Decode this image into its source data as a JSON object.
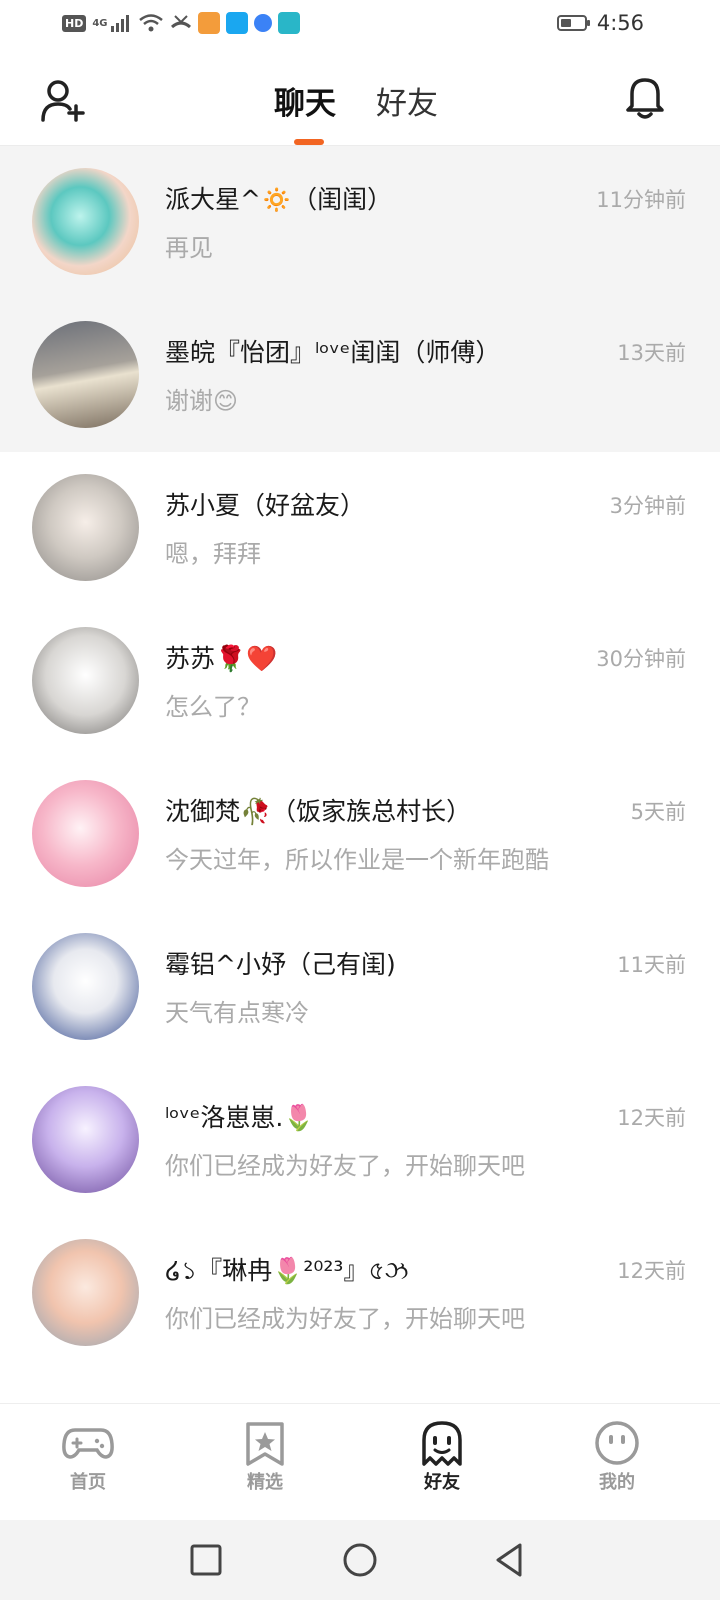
{
  "status_bar": {
    "network_hd": "HD",
    "network_gen": "4G",
    "time": "4:56",
    "battery_level": 0.45
  },
  "header": {
    "tab_chat": "聊天",
    "tab_friends": "好友",
    "active_tab": "聊天"
  },
  "conversations": [
    {
      "name": "派大星^🔅（闺闺）",
      "time": "11分钟前",
      "message": "再见",
      "highlighted": true
    },
    {
      "name": "墨皖『怡团』ˡᵒᵛᵉ闺闺（师傅）",
      "time": "13天前",
      "message": "谢谢😊",
      "highlighted": true
    },
    {
      "name": "苏小夏（好盆友）",
      "time": "3分钟前",
      "message": "嗯，拜拜",
      "highlighted": false
    },
    {
      "name": "苏苏🌹❤️",
      "time": "30分钟前",
      "message": "怎么了？",
      "highlighted": false
    },
    {
      "name": "沈御梵🥀（饭家族总村长）",
      "time": "5天前",
      "message": "今天过年，所以作业是一个新年跑酷",
      "highlighted": false
    },
    {
      "name": "霉铝^小妤（己有闺)",
      "time": "11天前",
      "message": "天气有点寒冷",
      "highlighted": false
    },
    {
      "name": "ˡᵒᵛᵉ洛崽崽.🌷",
      "time": "12天前",
      "message": "你们已经成为好友了，开始聊天吧",
      "highlighted": false
    },
    {
      "name": "໒১『琳冉🌷²⁰²³』৫ઝ",
      "time": "12天前",
      "message": "你们已经成为好友了，开始聊天吧",
      "highlighted": false
    }
  ],
  "bottom_nav": [
    {
      "label": "首页",
      "icon": "gamepad-icon",
      "active": false
    },
    {
      "label": "精选",
      "icon": "star-bookmark-icon",
      "active": false
    },
    {
      "label": "好友",
      "icon": "ghost-icon",
      "active": true
    },
    {
      "label": "我的",
      "icon": "smiley-face-icon",
      "active": false
    }
  ],
  "colors": {
    "accent": "#f26522",
    "muted_text": "#aaaaaa",
    "highlight_row": "#f4f4f4"
  }
}
